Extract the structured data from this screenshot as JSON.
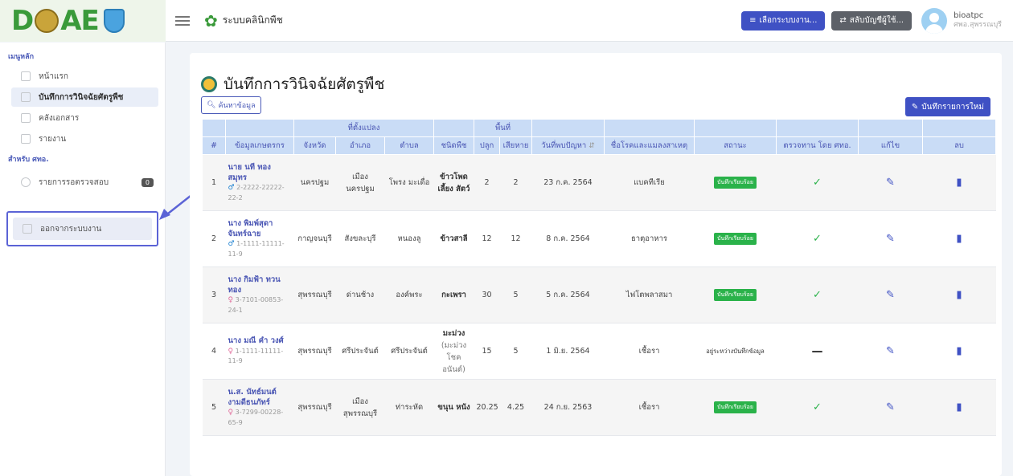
{
  "topbar": {
    "logo_text": "DOAE",
    "app_title": "ระบบคลินิกพืช",
    "system_button": "เลือกระบบงาน...",
    "switch_button": "สลับบัญชีผู้ใช้...",
    "user_name": "bioatpc",
    "user_role": "ศพอ.สุพรรณบุรี"
  },
  "sidebar": {
    "main_heading": "เมนูหลัก",
    "items": [
      {
        "label": "หน้าแรก",
        "icon": "home-icon"
      },
      {
        "label": "บันทึกการวินิจฉัยศัตรูพืช",
        "icon": "pen-icon"
      },
      {
        "label": "คลังเอกสาร",
        "icon": "folder-icon"
      },
      {
        "label": "รายงาน",
        "icon": "chart-icon"
      }
    ],
    "dept_heading": "สำหรับ ศทอ.",
    "review_label": "รายการรอตรวจสอบ",
    "review_badge": "0",
    "logout_label": "ออกจากระบบงาน"
  },
  "main": {
    "page_title": "บันทึกการวินิจฉัยศัตรูพืช",
    "search_button": "ค้นหาข้อมูล",
    "new_button": "บันทึกรายการใหม่",
    "group_headers": {
      "location": "ที่ตั้งแปลง",
      "area": "พื้นที่"
    },
    "columns": {
      "no": "#",
      "farmer": "ข้อมูลเกษตรกร",
      "province": "จังหวัด",
      "district": "อำเภอ",
      "subdistrict": "ตำบล",
      "plant": "ชนิดพืช",
      "planted": "ปลูก",
      "damaged": "เสียหาย",
      "found_date": "วันที่พบปัญหา",
      "disease": "ชื่อโรคและแมลงสาเหตุ",
      "status": "สถานะ",
      "checked": "ตรวจทาน โดย ศทอ.",
      "edit": "แก้ไข",
      "delete": "ลบ"
    },
    "rows": [
      {
        "no": "1",
        "name": "นาย นที ทอง สมุทร",
        "gender": "male",
        "id": "2-2222-22222-22-2",
        "province": "นครปฐม",
        "district": "เมือง นครปฐม",
        "subdistrict": "โพรง มะเดื่อ",
        "plant": "ข้าวโพด เลี้ยง สัตว์",
        "plant_sub": "",
        "planted": "2",
        "damaged": "2",
        "date": "23 ก.ค. 2564",
        "disease": "แบคทีเรีย",
        "status": "บันทึกเรียบร้อย",
        "status_type": "done",
        "checked": true
      },
      {
        "no": "2",
        "name": "นาง พิมพ์สุดา จันทร์ฉาย",
        "gender": "male",
        "id": "1-1111-11111-11-9",
        "province": "กาญจนบุรี",
        "district": "สังขละบุรี",
        "subdistrict": "หนองลู",
        "plant": "ข้าวสาลี",
        "plant_sub": "",
        "planted": "12",
        "damaged": "12",
        "date": "8 ก.ค. 2564",
        "disease": "ธาตุอาหาร",
        "status": "บันทึกเรียบร้อย",
        "status_type": "done",
        "checked": true
      },
      {
        "no": "3",
        "name": "นาง กิมฟ้า ทวนทอง",
        "gender": "female",
        "id": "3-7101-00853-24-1",
        "province": "สุพรรณบุรี",
        "district": "ด่านช้าง",
        "subdistrict": "องค์พระ",
        "plant": "กะเพรา",
        "plant_sub": "",
        "planted": "30",
        "damaged": "5",
        "date": "5 ก.ค. 2564",
        "disease": "ไฟโตพลาสมา",
        "status": "บันทึกเรียบร้อย",
        "status_type": "done",
        "checked": true
      },
      {
        "no": "4",
        "name": "นาง มณี คำ วงศ์",
        "gender": "female",
        "id": "1-1111-11111-11-9",
        "province": "สุพรรณบุรี",
        "district": "ศรีประจันต์",
        "subdistrict": "ศรีประจันต์",
        "plant": "มะม่วง",
        "plant_sub": "(มะม่วง โชค อนันต์)",
        "planted": "15",
        "damaged": "5",
        "date": "1 มิ.ย. 2564",
        "disease": "เชื้อรา",
        "status": "อยู่ระหว่างบันทึกข้อมูล",
        "status_type": "pending",
        "checked": false
      },
      {
        "no": "5",
        "name": "น.ส. นัทธ์มนต์ งามดีธนภัทร์",
        "gender": "female",
        "id": "3-7299-00228-65-9",
        "province": "สุพรรณบุรี",
        "district": "เมือง สุพรรณบุรี",
        "subdistrict": "ท่าระหัด",
        "plant": "ขนุน หนัง",
        "plant_sub": "",
        "planted": "20.25",
        "damaged": "4.25",
        "date": "24 ก.ย. 2563",
        "disease": "เชื้อรา",
        "status": "บันทึกเรียบร้อย",
        "status_type": "done",
        "checked": true
      }
    ]
  }
}
